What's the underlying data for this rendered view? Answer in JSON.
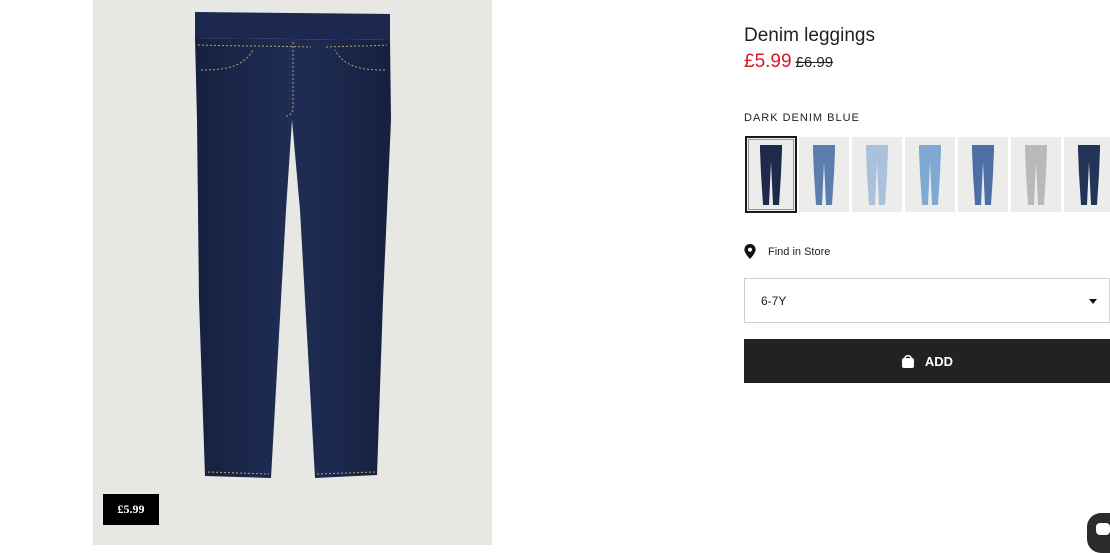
{
  "product": {
    "title": "Denim leggings",
    "price_sale": "£5.99",
    "price_original": "£6.99",
    "price_tag": "£5.99",
    "image_icon": "jeans-image"
  },
  "color": {
    "selected_label": "DARK DENIM BLUE",
    "swatches": [
      {
        "fill": "#1d2a4a",
        "icon": "jeans-icon"
      },
      {
        "fill": "#5a7fae",
        "icon": "jeans-icon"
      },
      {
        "fill": "#a9c1da",
        "icon": "jeans-icon"
      },
      {
        "fill": "#7fa8d3",
        "icon": "jeans-icon"
      },
      {
        "fill": "#4d6fa6",
        "icon": "jeans-icon"
      },
      {
        "fill": "#b9b9bc",
        "icon": "jeans-icon"
      },
      {
        "fill": "#223559",
        "icon": "jeans-icon"
      }
    ]
  },
  "store": {
    "label": "Find in Store",
    "icon": "location-pin-icon"
  },
  "size": {
    "value": "6-7Y",
    "icon": "chevron-down-icon"
  },
  "cart": {
    "add_label": "ADD",
    "icon": "shopping-bag-icon"
  },
  "colors": {
    "sale_red": "#d41a2a",
    "button_black": "#222222",
    "image_bg": "#e7e7e3"
  }
}
